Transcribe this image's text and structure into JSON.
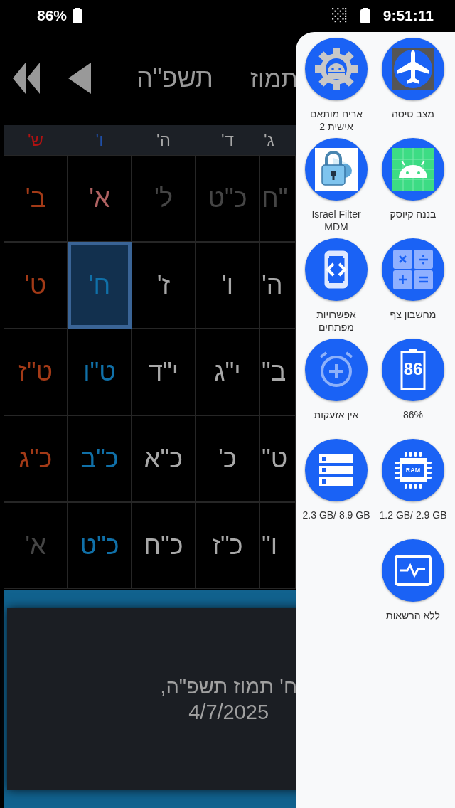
{
  "status_bar": {
    "battery_text": "86%",
    "time": "9:51:11"
  },
  "header": {
    "year": "תשפ\"ה",
    "month": "תמוז"
  },
  "calendar": {
    "weekdays": [
      {
        "label": "ג'",
        "color": "#a8a8a8"
      },
      {
        "label": "ד'",
        "color": "#a8a8a8"
      },
      {
        "label": "ה'",
        "color": "#a8a8a8"
      },
      {
        "label": "ו'",
        "color": "#1f4fa8"
      },
      {
        "label": "ש'",
        "color": "#b01212"
      }
    ],
    "rows": [
      [
        {
          "text": "\"ח",
          "color": "#454545",
          "selected": false
        },
        {
          "text": "כ\"ט",
          "color": "#454545",
          "selected": false
        },
        {
          "text": "ל'",
          "color": "#454545",
          "selected": false
        },
        {
          "text": "א'",
          "color": "#b06262",
          "selected": false
        },
        {
          "text": "ב'",
          "color": "#a33a17",
          "selected": false
        }
      ],
      [
        {
          "text": "ה'",
          "color": "#a8a8a8",
          "selected": false
        },
        {
          "text": "ו'",
          "color": "#a8a8a8",
          "selected": false
        },
        {
          "text": "ז'",
          "color": "#a8a8a8",
          "selected": false
        },
        {
          "text": "ח'",
          "color": "#1070a8",
          "selected": true
        },
        {
          "text": "ט'",
          "color": "#a33a17",
          "selected": false
        }
      ],
      [
        {
          "text": "ב\"",
          "color": "#a8a8a8",
          "selected": false
        },
        {
          "text": "י\"ג",
          "color": "#a8a8a8",
          "selected": false
        },
        {
          "text": "י\"ד",
          "color": "#a8a8a8",
          "selected": false
        },
        {
          "text": "ט\"ו",
          "color": "#1070a8",
          "selected": false
        },
        {
          "text": "ט\"ז",
          "color": "#a33a17",
          "selected": false
        }
      ],
      [
        {
          "text": "ט\"",
          "color": "#a8a8a8",
          "selected": false
        },
        {
          "text": "כ'",
          "color": "#a8a8a8",
          "selected": false
        },
        {
          "text": "כ\"א",
          "color": "#a8a8a8",
          "selected": false
        },
        {
          "text": "כ\"ב",
          "color": "#1070a8",
          "selected": false
        },
        {
          "text": "כ\"ג",
          "color": "#a33a17",
          "selected": false
        }
      ],
      [
        {
          "text": "ו\"",
          "color": "#a8a8a8",
          "selected": false
        },
        {
          "text": "כ\"ז",
          "color": "#a8a8a8",
          "selected": false
        },
        {
          "text": "כ\"ח",
          "color": "#a8a8a8",
          "selected": false
        },
        {
          "text": "כ\"ט",
          "color": "#1070a8",
          "selected": false
        },
        {
          "text": "א'",
          "color": "#454545",
          "selected": false
        }
      ]
    ]
  },
  "date_card": {
    "lines": [
      "ח' תמוז תשפ\"ה,",
      "4/7/2025"
    ]
  },
  "quick_panel": {
    "tiles": [
      {
        "label": "מצב טיסה",
        "kind": "airplane",
        "active": true
      },
      {
        "label": "אריח מותאם אישית 2",
        "kind": "gear",
        "active": true
      },
      {
        "label": "בננה קיוסק",
        "kind": "android",
        "active": true
      },
      {
        "label": "Israel Filter MDM",
        "kind": "lock",
        "active": true
      },
      {
        "label": "מחשבון צף",
        "kind": "calculator",
        "active": true
      },
      {
        "label": "אפשרויות מפתחים",
        "kind": "code",
        "active": true
      },
      {
        "label": "86%",
        "kind": "battery",
        "icon_text": "86",
        "active": true
      },
      {
        "label": "אין אזעקות",
        "kind": "alarm",
        "active": false
      },
      {
        "label": "1.2 GB/ 2.9 GB",
        "kind": "ram",
        "icon_text": "RAM",
        "active": true
      },
      {
        "label": "2.3 GB/ 8.9 GB",
        "kind": "storage",
        "active": true
      },
      {
        "label": "ללא הרשאות",
        "kind": "monitor",
        "active": true
      }
    ]
  }
}
